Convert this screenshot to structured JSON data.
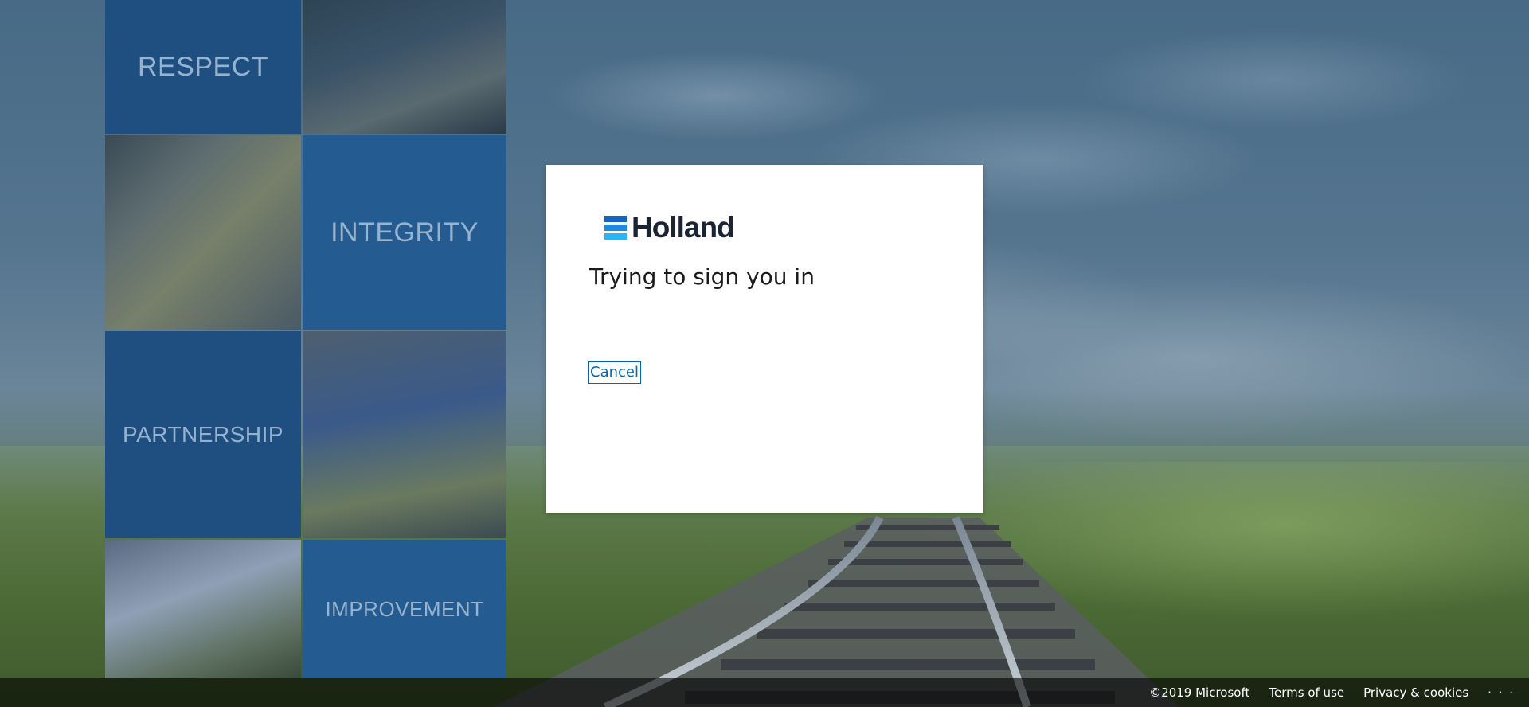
{
  "brand": {
    "name": "Holland",
    "accent_colors": [
      "#1565c0",
      "#1e88e5",
      "#29b6f6"
    ]
  },
  "background_tiles": [
    {
      "label": "RESPECT"
    },
    {
      "label": "INTEGRITY"
    },
    {
      "label": "PARTNERSHIP"
    },
    {
      "label": "IMPROVEMENT"
    }
  ],
  "dialog": {
    "title": "Trying to sign you in",
    "cancel_label": "Cancel"
  },
  "footer": {
    "copyright": "©2019 Microsoft",
    "terms_label": "Terms of use",
    "privacy_label": "Privacy & cookies",
    "more_label": "· · ·"
  },
  "colors": {
    "link": "#0067b8",
    "footer_bg": "rgba(0,0,0,0.6)"
  }
}
